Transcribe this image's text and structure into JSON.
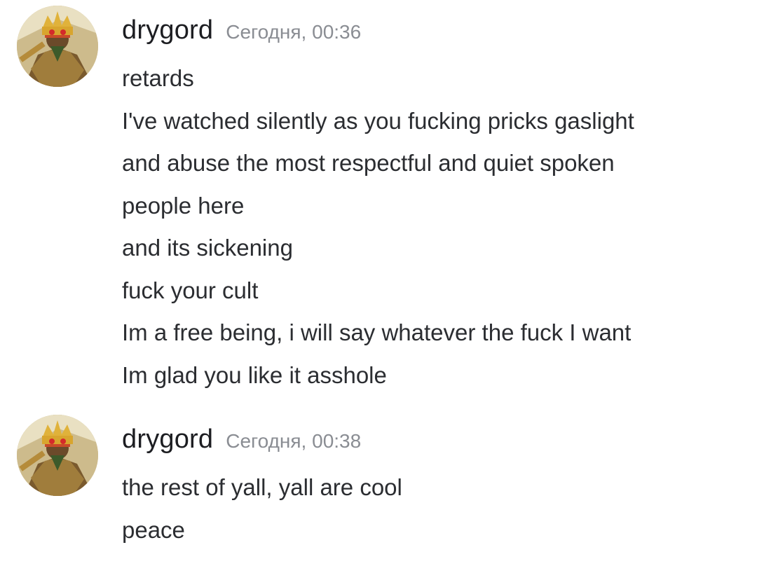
{
  "messages": [
    {
      "author": "drygord",
      "timestamp": "Сегодня, 00:36",
      "avatar_icon": "crowned-warrior-avatar",
      "lines": [
        "retards",
        "I've watched silently as you fucking pricks gaslight",
        "and abuse the most respectful and quiet spoken",
        "people here",
        "and its sickening",
        "fuck your cult",
        "Im a free being, i will say whatever the fuck I want",
        "Im glad you like it asshole"
      ]
    },
    {
      "author": "drygord",
      "timestamp": "Сегодня, 00:38",
      "avatar_icon": "crowned-warrior-avatar",
      "lines": [
        "the rest of yall, yall are cool",
        "peace"
      ]
    }
  ],
  "colors": {
    "background": "#ffffff",
    "username": "#1c1d21",
    "timestamp": "#8a8d93",
    "message_text": "#2b2d31"
  }
}
